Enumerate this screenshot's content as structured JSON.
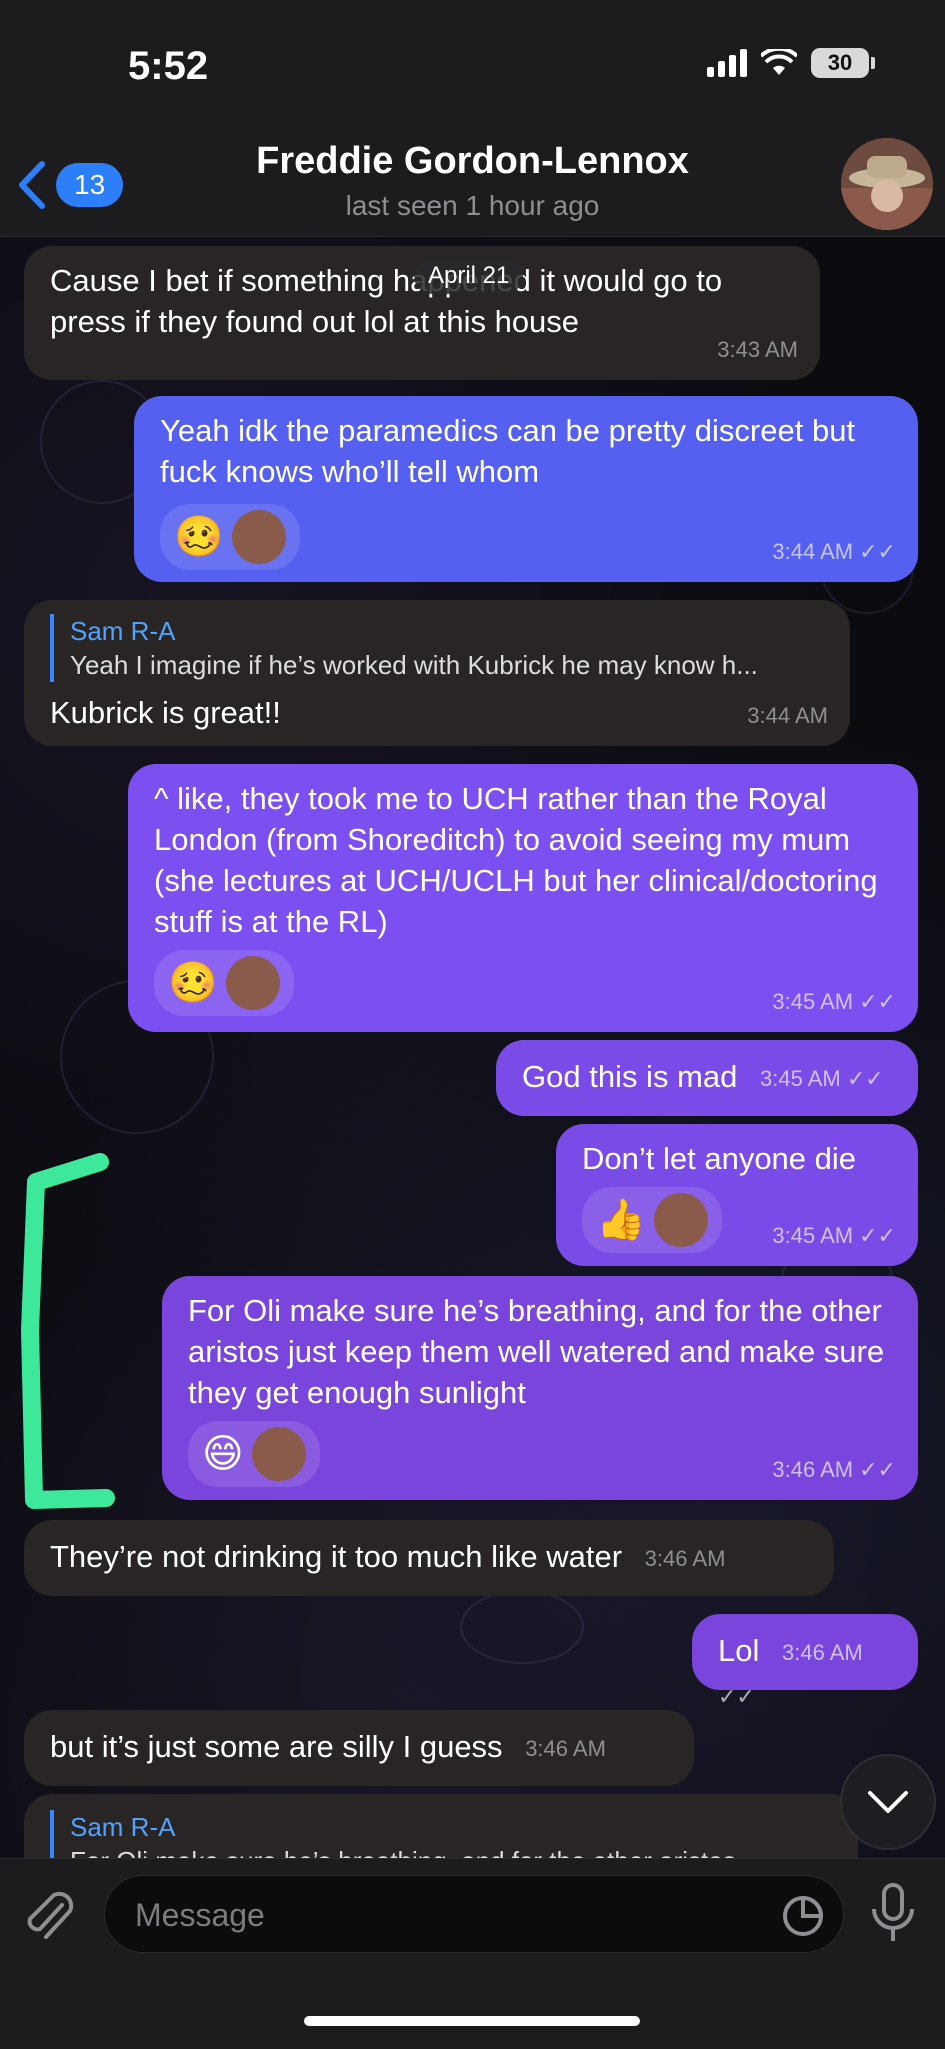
{
  "status": {
    "time": "5:52",
    "battery": "30"
  },
  "header": {
    "back_count": "13",
    "title": "Freddie Gordon-Lennox",
    "subtitle": "last seen 1 hour ago"
  },
  "date_pill": "April 21",
  "messages": [
    {
      "text": "Cause I bet if something happened it would go to press if they found out lol at this house",
      "time": "3:43 AM"
    },
    {
      "text": "Yeah idk the paramedics can be pretty discreet but fuck knows who’ll tell whom",
      "time": "3:44 AM",
      "reaction": "🥴"
    },
    {
      "reply_name": "Sam R-A",
      "reply_text": "Yeah I imagine if he’s worked with Kubrick he may know h...",
      "text": "Kubrick is great!!",
      "time": "3:44 AM"
    },
    {
      "text": "^ like, they took me to UCH rather than the Royal London (from Shoreditch) to avoid seeing my mum (she lectures at UCH/UCLH but her clinical/doctoring stuff is at the RL)",
      "time": "3:45 AM",
      "reaction": "🥴"
    },
    {
      "text": "God this is mad",
      "time": "3:45 AM"
    },
    {
      "text": "Don’t let anyone die",
      "time": "3:45 AM",
      "reaction": "👍"
    },
    {
      "text": "For Oli make sure he’s breathing, and for the other aristos just keep them well watered and make sure they get enough sunlight",
      "time": "3:46 AM",
      "reaction": "😄"
    },
    {
      "text": "They’re not drinking it too much like water",
      "time": "3:46 AM"
    },
    {
      "text": "Lol",
      "time": "3:46 AM"
    },
    {
      "text": "but it’s just some are silly I guess",
      "time": "3:46 AM"
    },
    {
      "reply_name": "Sam R-A",
      "reply_text": "For Oli make sure he’s breathing, and for the other aristos"
    }
  ],
  "input": {
    "placeholder": "Message"
  },
  "colors": {
    "accent": "#2d7ff9",
    "outgoing": "#7a48e0",
    "incoming": "#2a2525",
    "annotation": "#3de89a"
  }
}
